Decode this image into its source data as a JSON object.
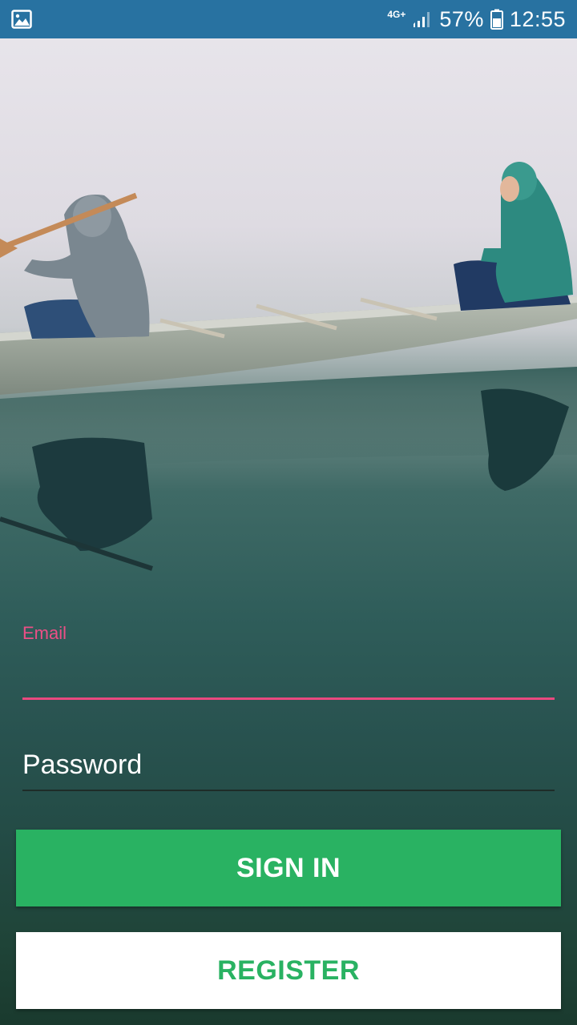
{
  "status_bar": {
    "network": "4G+",
    "battery": "57%",
    "time": "12:55"
  },
  "form": {
    "email_label": "Email",
    "email_value": "",
    "password_placeholder": "Password",
    "signin_label": "SIGN IN",
    "register_label": "REGISTER"
  },
  "colors": {
    "status_bar": "#2872a1",
    "accent_pink": "#ec4f86",
    "primary_green": "#29b262"
  }
}
